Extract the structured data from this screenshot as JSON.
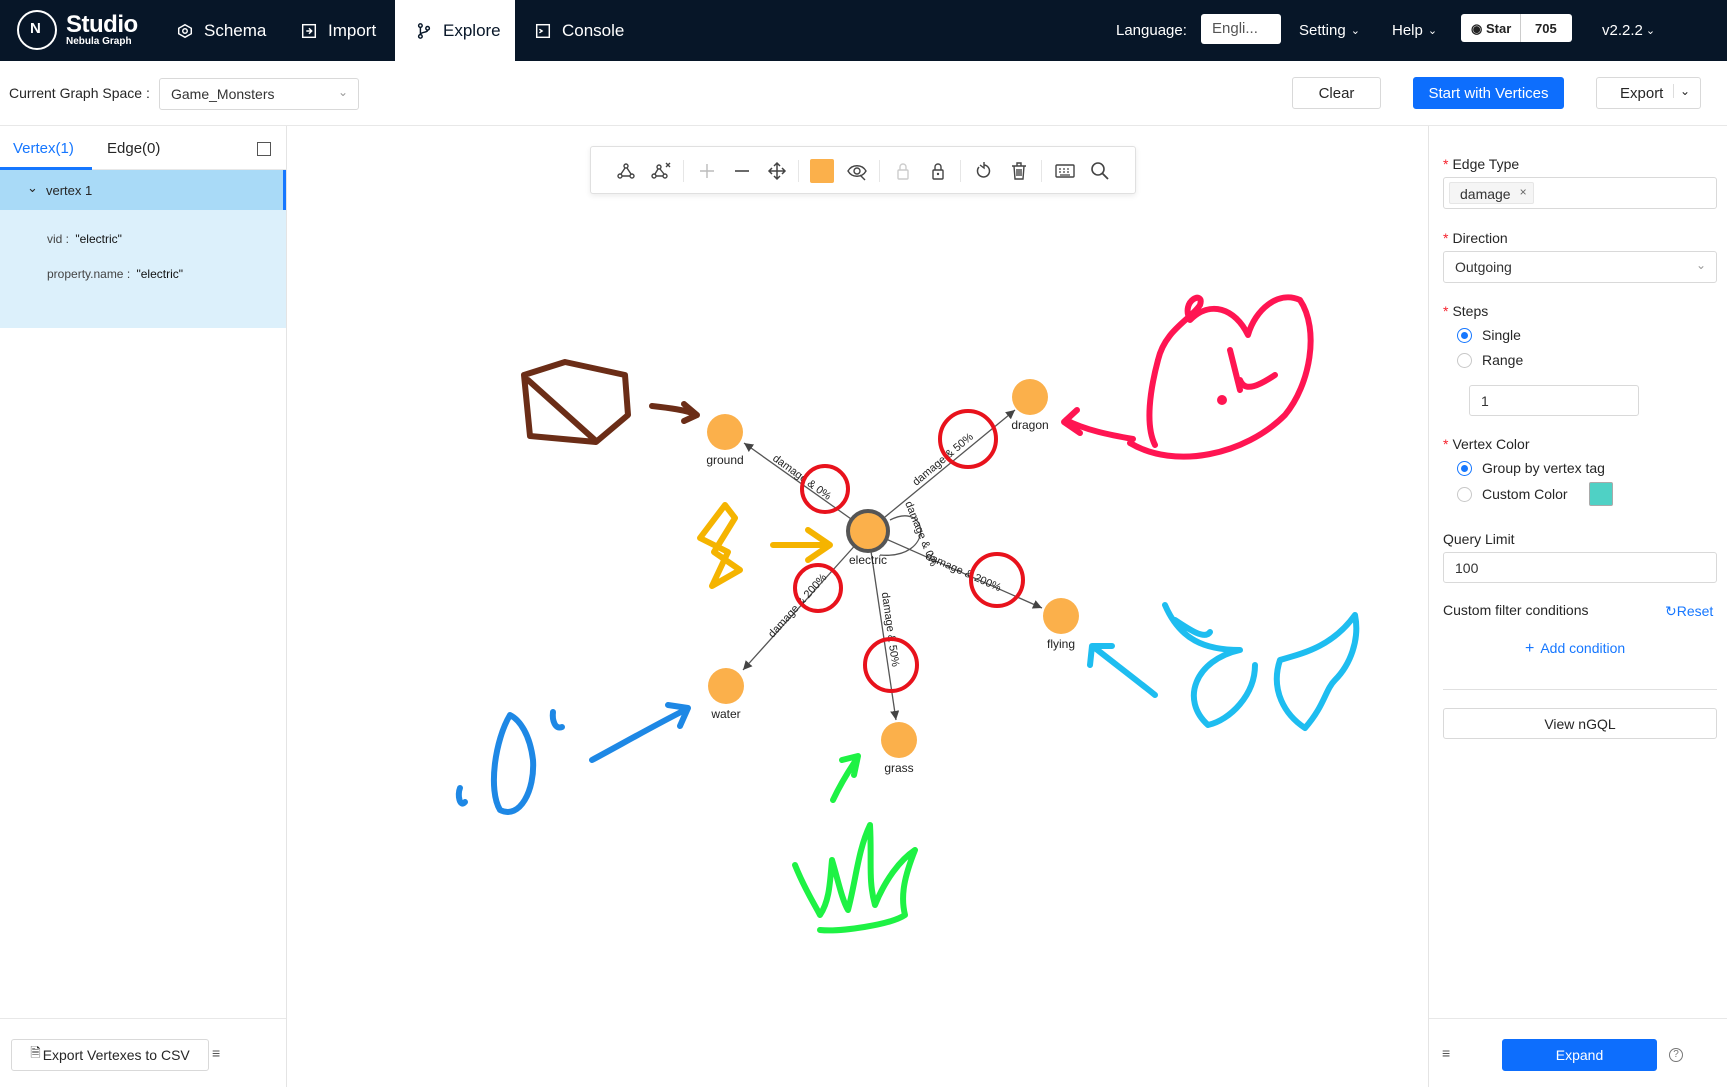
{
  "app": {
    "name": "Studio",
    "subtitle": "Nebula Graph",
    "logo_letter": "N"
  },
  "nav": [
    {
      "label": "Schema",
      "icon": "schema-icon"
    },
    {
      "label": "Import",
      "icon": "import-icon"
    },
    {
      "label": "Explore",
      "icon": "explore-icon",
      "active": true
    },
    {
      "label": "Console",
      "icon": "console-icon"
    }
  ],
  "topright": {
    "language_label": "Language:",
    "language_value": "Engli...",
    "setting": "Setting",
    "help": "Help",
    "star_label": "Star",
    "star_count": "705",
    "version": "v2.2.2"
  },
  "space": {
    "label": "Current Graph Space :",
    "value": "Game_Monsters"
  },
  "actions": {
    "clear": "Clear",
    "start": "Start with Vertices",
    "export": "Export"
  },
  "left": {
    "tabs": {
      "vertex": "Vertex(1)",
      "edge": "Edge(0)"
    },
    "item": "vertex 1",
    "props": [
      {
        "key": "vid :",
        "value": "\"electric\""
      },
      {
        "key": "property.name :",
        "value": "\"electric\""
      }
    ],
    "export_csv": "Export Vertexes to CSV"
  },
  "graph": {
    "center": "electric",
    "nodes": [
      "ground",
      "dragon",
      "flying",
      "grass",
      "water"
    ],
    "edge_labels": [
      "damage & 0%",
      "damage & 50%",
      "damage & 200%",
      "damage & 50%",
      "damage & 200%",
      "damage & 0%"
    ]
  },
  "right": {
    "edge_type_label": "Edge Type",
    "edge_type_tag": "damage",
    "direction_label": "Direction",
    "direction_value": "Outgoing",
    "steps_label": "Steps",
    "steps_single": "Single",
    "steps_range": "Range",
    "steps_value": "1",
    "vertex_color_label": "Vertex Color",
    "color_group": "Group by vertex tag",
    "color_custom": "Custom Color",
    "custom_color": "#4fd1c5",
    "query_limit_label": "Query Limit",
    "query_limit_value": "100",
    "filter_label": "Custom filter conditions",
    "reset": "Reset",
    "add_condition": "Add condition",
    "view_ngql": "View nGQL",
    "expand": "Expand"
  },
  "colors": {
    "topbar": "#071628",
    "primary": "#0d6efd",
    "node": "#fbb04b",
    "selected": "#c6e5f7"
  }
}
